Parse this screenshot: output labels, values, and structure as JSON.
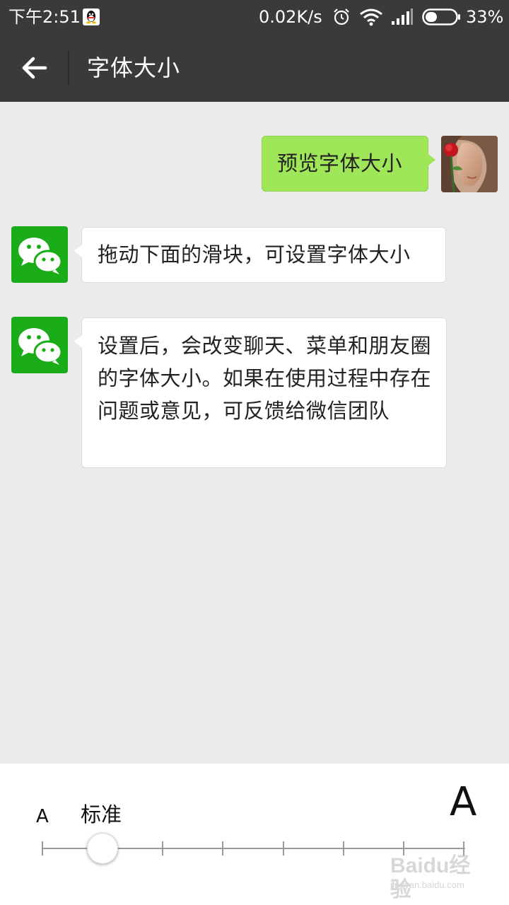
{
  "status_bar": {
    "time": "下午2:51",
    "network_speed": "0.02K/s",
    "battery": "33%",
    "icons": [
      "qq-icon",
      "alarm-icon",
      "wifi-icon",
      "signal-icon",
      "battery-icon"
    ]
  },
  "header": {
    "title": "字体大小",
    "back_icon": "back-arrow-icon"
  },
  "chat": {
    "self_message": "预览字体大小",
    "messages": [
      {
        "text": "拖动下面的滑块，可设置字体大小"
      },
      {
        "text": "设置后，会改变聊天、菜单和朋友圈的字体大小。如果在使用过程中存在问题或意见，可反馈给微信团队"
      }
    ]
  },
  "font_slider": {
    "small_label": "A",
    "current_label": "标准",
    "large_label": "A",
    "steps": 8,
    "selected_index": 1
  },
  "watermark": {
    "brand": "Baidu经验",
    "url": "jingyan.baidu.com"
  },
  "colors": {
    "bar": "#3a3a3c",
    "background": "#ebebeb",
    "self_bubble": "#9fe658",
    "wechat_green": "#1aad19"
  }
}
